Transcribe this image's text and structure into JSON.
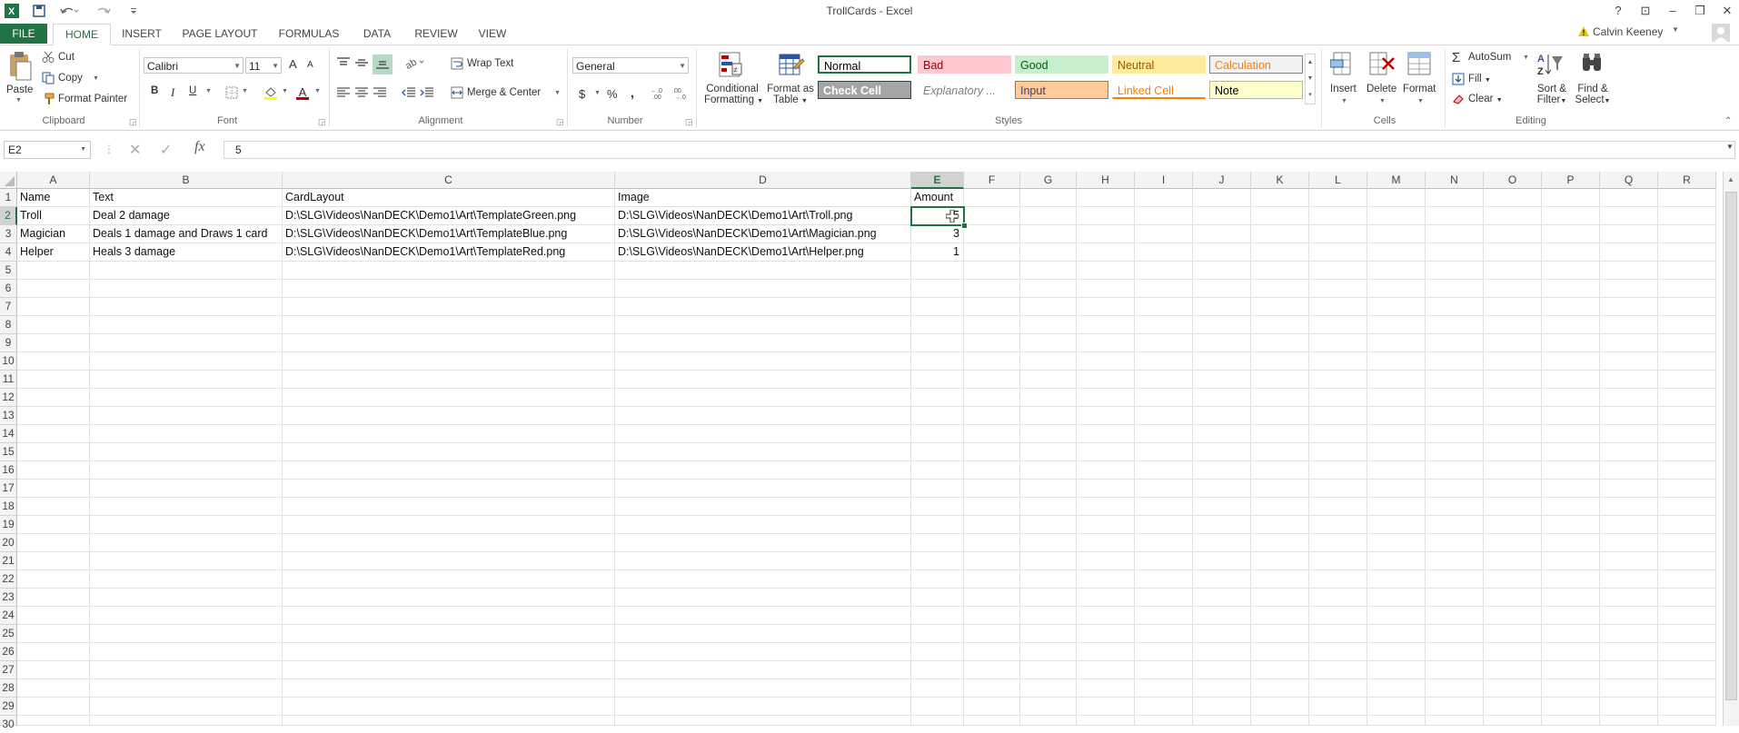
{
  "window": {
    "title": "TrollCards - Excel",
    "user": "Calvin Keeney"
  },
  "qat": {
    "app_icon": "X",
    "save_icon": "floppy-icon",
    "undo_icon": "undo-icon",
    "redo_icon": "redo-icon"
  },
  "tabs": [
    "FILE",
    "HOME",
    "INSERT",
    "PAGE LAYOUT",
    "FORMULAS",
    "DATA",
    "REVIEW",
    "VIEW"
  ],
  "clipboard": {
    "paste": "Paste",
    "cut": "Cut",
    "copy": "Copy",
    "format_painter": "Format Painter",
    "label": "Clipboard"
  },
  "font": {
    "name": "Calibri",
    "size": "11",
    "bold": "B",
    "italic": "I",
    "underline": "U",
    "grow": "A",
    "shrink": "A",
    "font_color": "A",
    "label": "Font"
  },
  "alignment": {
    "wrap_text": "Wrap Text",
    "merge_center": "Merge & Center",
    "label": "Alignment"
  },
  "number": {
    "format": "General",
    "currency": "$",
    "percent": "%",
    "comma": ",",
    "label": "Number"
  },
  "styles": {
    "conditional": [
      "Conditional",
      "Formatting"
    ],
    "format_table": [
      "Format as",
      "Table"
    ],
    "boxes": [
      {
        "label": "Normal",
        "bg": "#ffffff",
        "fg": "#000000",
        "border": "#217346"
      },
      {
        "label": "Bad",
        "bg": "#ffc7ce",
        "fg": "#9c0006",
        "border": "#ffc7ce"
      },
      {
        "label": "Good",
        "bg": "#c6efce",
        "fg": "#006100",
        "border": "#c6efce"
      },
      {
        "label": "Neutral",
        "bg": "#ffeb9c",
        "fg": "#9c5700",
        "border": "#ffeb9c"
      },
      {
        "label": "Calculation",
        "bg": "#f2f2f2",
        "fg": "#fa7d00",
        "border": "#7f7f7f"
      },
      {
        "label": "Check Cell",
        "bg": "#a5a5a5",
        "fg": "#ffffff",
        "border": "#3f3f3f"
      },
      {
        "label": "Explanatory ...",
        "bg": "#ffffff",
        "fg": "#7f7f7f",
        "border": "#ffffff"
      },
      {
        "label": "Input",
        "bg": "#ffcc99",
        "fg": "#3f3f76",
        "border": "#7f7f7f"
      },
      {
        "label": "Linked Cell",
        "bg": "#ffffff",
        "fg": "#fa7d00",
        "border": "#ffffff"
      },
      {
        "label": "Note",
        "bg": "#ffffcc",
        "fg": "#000000",
        "border": "#b2b2b2"
      }
    ],
    "label": "Styles"
  },
  "cells_group": {
    "insert": "Insert",
    "delete": "Delete",
    "format": "Format",
    "label": "Cells"
  },
  "editing": {
    "autosum": "AutoSum",
    "fill": "Fill",
    "clear": "Clear",
    "sort": [
      "Sort &",
      "Filter"
    ],
    "find": [
      "Find &",
      "Select"
    ],
    "label": "Editing"
  },
  "formula_bar": {
    "name_box": "E2",
    "fx": "fx",
    "value": "5"
  },
  "columns": [
    "A",
    "B",
    "C",
    "D",
    "E",
    "F",
    "G",
    "H",
    "I",
    "J",
    "K",
    "L",
    "M",
    "N",
    "O",
    "P",
    "Q",
    "R"
  ],
  "rows": [
    "1",
    "2",
    "3",
    "4",
    "5",
    "6",
    "7",
    "8",
    "9",
    "10",
    "11",
    "12",
    "13",
    "14",
    "15",
    "16",
    "17",
    "18",
    "19",
    "20",
    "21",
    "22",
    "23",
    "24",
    "25",
    "26",
    "27",
    "28",
    "29",
    "30"
  ],
  "sheet": {
    "headers": [
      "Name",
      "Text",
      "CardLayout",
      "Image",
      "Amount"
    ],
    "data": [
      [
        "Troll",
        "Deal 2 damage",
        "D:\\SLG\\Videos\\NanDECK\\Demo1\\Art\\TemplateGreen.png",
        "D:\\SLG\\Videos\\NanDECK\\Demo1\\Art\\Troll.png",
        "5"
      ],
      [
        "Magician",
        "Deals 1 damage and Draws 1 card",
        "D:\\SLG\\Videos\\NanDECK\\Demo1\\Art\\TemplateBlue.png",
        "D:\\SLG\\Videos\\NanDECK\\Demo1\\Art\\Magician.png",
        "3"
      ],
      [
        "Helper",
        "Heals 3 damage",
        "D:\\SLG\\Videos\\NanDECK\\Demo1\\Art\\TemplateRed.png",
        "D:\\SLG\\Videos\\NanDECK\\Demo1\\Art\\Helper.png",
        "1"
      ]
    ]
  }
}
